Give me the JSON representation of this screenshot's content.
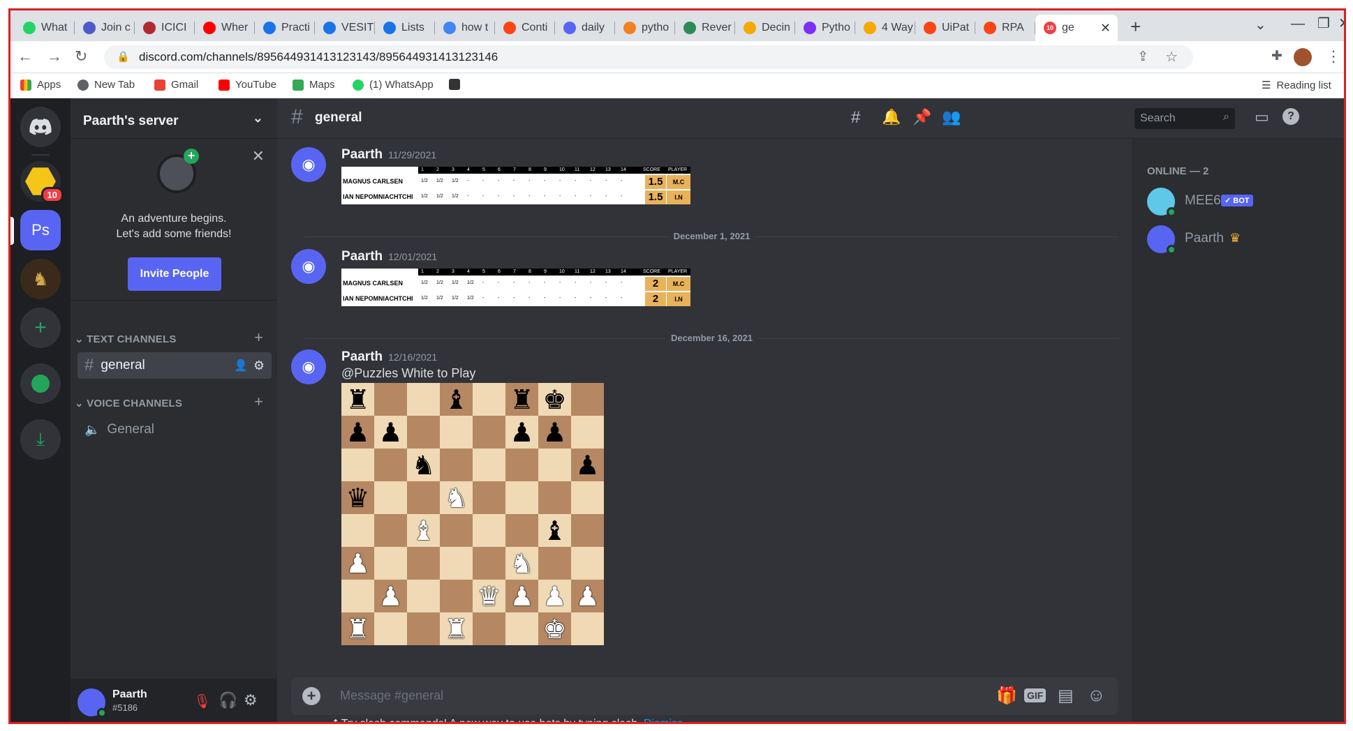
{
  "browser": {
    "tabs": [
      {
        "label": "What",
        "color": "#25d366"
      },
      {
        "label": "Join c",
        "color": "#5059c9"
      },
      {
        "label": "ICICI",
        "color": "#b02a30"
      },
      {
        "label": "Wher",
        "color": "#ff0000"
      },
      {
        "label": "Practi",
        "color": "#1a73e8"
      },
      {
        "label": "VESIT",
        "color": "#1a73e8"
      },
      {
        "label": "Lists",
        "color": "#1a73e8"
      },
      {
        "label": "how t",
        "color": "#4285f4"
      },
      {
        "label": "Conti",
        "color": "#fa4616"
      },
      {
        "label": "daily",
        "color": "#5865f2"
      },
      {
        "label": "pytho",
        "color": "#f48024"
      },
      {
        "label": "Rever",
        "color": "#2e8b57"
      },
      {
        "label": "Decin",
        "color": "#f5a800"
      },
      {
        "label": "Pytho",
        "color": "#7b2ff7"
      },
      {
        "label": "4 Way",
        "color": "#f5a800"
      },
      {
        "label": "UiPat",
        "color": "#fa4616"
      },
      {
        "label": "RPA",
        "color": "#fa4616"
      }
    ],
    "active_tab": {
      "label": "ge",
      "badge": "10"
    },
    "url": "discord.com/channels/895644931413123143/895644931413123146",
    "bookmarks": [
      "Apps",
      "New Tab",
      "Gmail",
      "YouTube",
      "Maps",
      "(1) WhatsApp"
    ],
    "reading_list": "Reading list"
  },
  "guilds": {
    "codecell_badge": "10",
    "selected_server_initials": "Ps"
  },
  "sidebar": {
    "server_name": "Paarth's server",
    "friend_card_line1": "An adventure begins.",
    "friend_card_line2": "Let's add some friends!",
    "invite_label": "Invite People",
    "text_category": "TEXT CHANNELS",
    "text_channel": "general",
    "voice_category": "VOICE CHANNELS",
    "voice_channel": "General"
  },
  "user": {
    "name": "Paarth",
    "tag": "#5186"
  },
  "chat": {
    "channel_name": "general",
    "search_placeholder": "Search",
    "messages": [
      {
        "author": "Paarth",
        "time": "11/29/2021"
      },
      {
        "author": "Paarth",
        "time": "12/01/2021"
      },
      {
        "author": "Paarth",
        "time": "12/16/2021",
        "text": "@Puzzles White to Play"
      }
    ],
    "dividers": [
      "December 1, 2021",
      "December 16, 2021"
    ],
    "scoreboards": [
      {
        "players": [
          "MAGNUS CARLSEN",
          "IAN NEPOMNIACHTCHI"
        ],
        "games": [
          "1/2",
          "1/2",
          "1/2"
        ],
        "points": [
          "1.5",
          "1.5"
        ],
        "initials": [
          "M.C",
          "I.N"
        ]
      },
      {
        "players": [
          "MAGNUS CARLSEN",
          "IAN NEPOMNIACHTCHI"
        ],
        "games": [
          "1/2",
          "1/2",
          "1/2",
          "1/2"
        ],
        "points": [
          "2",
          "2"
        ],
        "initials": [
          "M.C",
          "I.N"
        ]
      }
    ],
    "scoreboard_header": {
      "rounds": [
        "1",
        "2",
        "3",
        "4",
        "5",
        "6",
        "7",
        "8",
        "9",
        "10",
        "11",
        "12",
        "13",
        "14"
      ],
      "score": "SCORE",
      "player": "PLAYER"
    },
    "board": [
      [
        "bR",
        "",
        "",
        "bB",
        "",
        "bR",
        "bK",
        ""
      ],
      [
        "bP",
        "bP",
        "",
        "",
        "",
        "bP",
        "bP",
        ""
      ],
      [
        "",
        "",
        "bN",
        "",
        "",
        "",
        "",
        "bP"
      ],
      [
        "bQ",
        "",
        "",
        "wN",
        "",
        "",
        "",
        ""
      ],
      [
        "",
        "",
        "wB",
        "",
        "",
        "",
        "bB",
        ""
      ],
      [
        "wP",
        "",
        "",
        "",
        "",
        "wN",
        "",
        ""
      ],
      [
        "",
        "wP",
        "",
        "",
        "wQ",
        "wP",
        "wP",
        "wP"
      ],
      [
        "wR",
        "",
        "",
        "wR",
        "",
        "",
        "wK",
        ""
      ]
    ],
    "composer_placeholder": "Message #general",
    "tip_text": "Try slash commands! A new way to use bots by typing slash.",
    "tip_dismiss": "Dismiss",
    "gif_label": "GIF"
  },
  "members": {
    "heading": "ONLINE — 2",
    "list": [
      {
        "name": "MEE6",
        "badge": "✓ BOT",
        "color": "#43b581"
      },
      {
        "name": "Paarth",
        "crown": "♛",
        "color": "#5865f2"
      }
    ]
  },
  "colors": {
    "blurple": "#5865f2",
    "green": "#23a55a",
    "red_badge": "#f23f43",
    "link": "#00a8fc"
  }
}
